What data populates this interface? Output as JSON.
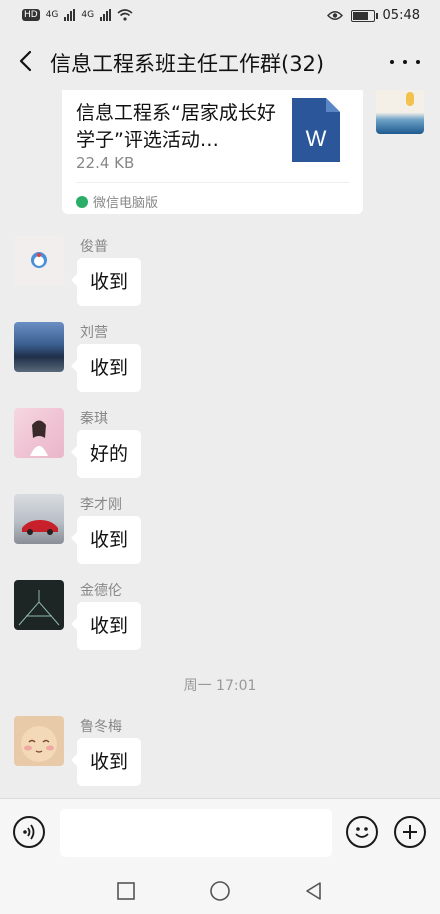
{
  "status_bar": {
    "left_badge": "HD",
    "network_1": "4G",
    "network_2": "4G",
    "time": "05:48",
    "icons": [
      "hd-icon",
      "signal-icon",
      "wifi-icon",
      "eye-icon",
      "battery-icon"
    ],
    "battery_level": 0.85
  },
  "header": {
    "title": "信息工程系班主任工作群(32)",
    "back_icon": "chevron-left-icon",
    "more_icon": "more-dots-icon"
  },
  "file_message": {
    "file_name": "信息工程系“居家成长好学子”评选活动…",
    "file_size": "22.4 KB",
    "source": "微信电脑版",
    "file_icon_letter": "W",
    "file_icon_color": "#2b579a"
  },
  "messages": [
    {
      "sender": "俊普",
      "text": "收到"
    },
    {
      "sender": "刘营",
      "text": "收到"
    },
    {
      "sender": "秦琪",
      "text": "好的"
    },
    {
      "sender": "李才刚",
      "text": "收到"
    },
    {
      "sender": "金德伦",
      "text": "收到"
    }
  ],
  "timestamp": "周一 17:01",
  "last_message": {
    "sender": "鲁冬梅",
    "text": "收到"
  },
  "input_bar": {
    "placeholder": "",
    "voice_icon": "voice-icon",
    "emoji_icon": "emoji-icon",
    "add_icon": "plus-circle-icon"
  },
  "nav_bar": {
    "icons": [
      "square-icon",
      "circle-icon",
      "triangle-back-icon"
    ]
  }
}
